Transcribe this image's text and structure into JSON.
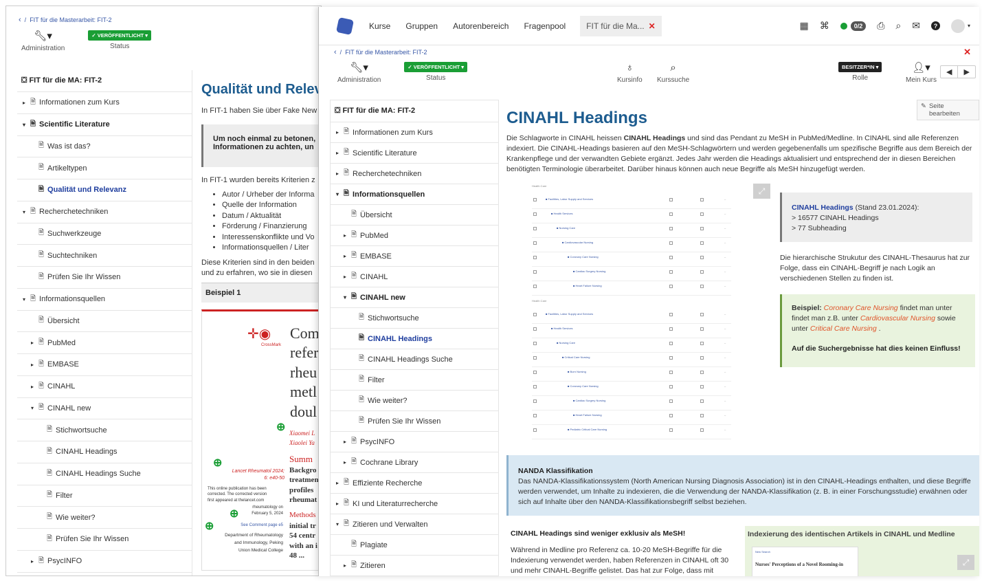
{
  "back": {
    "breadcrumb": {
      "back_icon": "chevron-left-icon",
      "sep": "/",
      "label": "FIT für die Masterarbeit: FIT-2"
    },
    "toolbar": {
      "admin": "Administration",
      "publish": "✓ VERÖFFENTLICHT ▾",
      "status": "Status"
    },
    "menu": {
      "title": "FIT für die MA: FIT-2",
      "items": [
        {
          "label": "Informationen zum Kurs",
          "caret": "▸",
          "level": 0
        },
        {
          "label": "Scientific Literature",
          "caret": "▾",
          "level": 0
        },
        {
          "label": "Was ist das?",
          "caret": "",
          "level": 1
        },
        {
          "label": "Artikeltypen",
          "caret": "",
          "level": 1
        },
        {
          "label": "Qualität und Relevanz",
          "caret": "",
          "level": 1
        },
        {
          "label": "Recherchetechniken",
          "caret": "▾",
          "level": 0
        },
        {
          "label": "Suchwerkzeuge",
          "caret": "",
          "level": 1
        },
        {
          "label": "Suchtechniken",
          "caret": "",
          "level": 1
        },
        {
          "label": "Prüfen Sie Ihr Wissen",
          "caret": "",
          "level": 1
        },
        {
          "label": "Informationsquellen",
          "caret": "▾",
          "level": 0
        },
        {
          "label": "Übersicht",
          "caret": "",
          "level": 1
        },
        {
          "label": "PubMed",
          "caret": "▸",
          "level": 1
        },
        {
          "label": "EMBASE",
          "caret": "▸",
          "level": 1
        },
        {
          "label": "CINAHL",
          "caret": "▸",
          "level": 1
        },
        {
          "label": "CINAHL new",
          "caret": "▾",
          "level": 1
        },
        {
          "label": "Stichwortsuche",
          "caret": "",
          "level": 2
        },
        {
          "label": "CINAHL Headings",
          "caret": "",
          "level": 2
        },
        {
          "label": "CINAHL Headings Suche",
          "caret": "",
          "level": 2
        },
        {
          "label": "Filter",
          "caret": "",
          "level": 2
        },
        {
          "label": "Wie weiter?",
          "caret": "",
          "level": 2
        },
        {
          "label": "Prüfen Sie Ihr Wissen",
          "caret": "",
          "level": 2
        },
        {
          "label": "PsycINFO",
          "caret": "▸",
          "level": 1
        }
      ]
    },
    "content": {
      "title": "Qualität und Relev",
      "intro": "In FIT-1 haben Sie über Fake New",
      "box": "Um noch einmal zu betonen,\nInformationen zu achten, un",
      "criteria_intro": "In FIT-1 wurden bereits Kriterien z",
      "criteria": [
        "Autor / Urheber der Informa",
        "Quelle der Information",
        "Datum / Aktualität",
        "Förderung / Finanzierung",
        "Interessenskonflikte und Vo",
        "Informationsquellen / Liter"
      ],
      "after": "Diese Kriterien sind in den beiden\nund zu erfahren, wo sie in diesen",
      "example_label": "Beispiel 1",
      "paper": {
        "logo": "CrossMark",
        "title_lines": [
          "Com",
          "refer",
          "rheu",
          "metl",
          "doul"
        ],
        "authors1": "Xiaomei L",
        "authors2": "Xiaolei Ya",
        "summary": "Summ",
        "summary_lines": [
          "Backgro",
          "treatmen",
          "profiles",
          "rheumat"
        ],
        "journal": "Lancet Rheumatol 2024;\n6: e40-50",
        "online_note": "This online publication has been\ncorrected. The corrected version\nfirst appeared at thelancet.com",
        "rheum": "rheumatology on\nFebruary 5, 2024",
        "see_comment": "See Comment page e5",
        "dept": "Department of Rheumatology\nand Immunology, Peking\nUnion Medical College",
        "methods": "Methods",
        "methods_lines": [
          "initial tr",
          "54 centr",
          "with an i",
          "48 ..."
        ]
      }
    }
  },
  "front": {
    "nav": {
      "items": [
        "Kurse",
        "Gruppen",
        "Autorenbereich",
        "Fragenpool"
      ],
      "active_tab": "FIT für die Ma...",
      "close": "✕",
      "badge": "0/2",
      "icons": [
        "calendar-icon",
        "rss-icon",
        "online-dot-icon",
        "print-icon",
        "search-icon",
        "mail-icon",
        "help-icon",
        "avatar"
      ]
    },
    "breadcrumb": {
      "label": "FIT für die Masterarbeit: FIT-2",
      "sep": "/",
      "close": "✕"
    },
    "toolbar": {
      "admin": "Administration",
      "publish": "✓ VERÖFFENTLICHT ▾",
      "status": "Status",
      "kursinfo": "Kursinfo",
      "kurssuche": "Kurssuche",
      "role_btn": "BESITZER*IN ▾",
      "role": "Rolle",
      "mein_kurs": "Mein Kurs"
    },
    "menu": {
      "title": "FIT für die MA: FIT-2",
      "items": [
        {
          "label": "Informationen zum Kurs",
          "caret": "▸",
          "level": 0
        },
        {
          "label": "Scientific Literature",
          "caret": "▸",
          "level": 0
        },
        {
          "label": "Recherchetechniken",
          "caret": "▸",
          "level": 0
        },
        {
          "label": "Informationsquellen",
          "caret": "▾",
          "level": 0
        },
        {
          "label": "Übersicht",
          "caret": "",
          "level": 1
        },
        {
          "label": "PubMed",
          "caret": "▸",
          "level": 1
        },
        {
          "label": "EMBASE",
          "caret": "▸",
          "level": 1
        },
        {
          "label": "CINAHL",
          "caret": "▸",
          "level": 1
        },
        {
          "label": "CINAHL new",
          "caret": "▾",
          "level": 1
        },
        {
          "label": "Stichwortsuche",
          "caret": "",
          "level": 2
        },
        {
          "label": "CINAHL Headings",
          "caret": "",
          "level": 2
        },
        {
          "label": "CINAHL Headings Suche",
          "caret": "",
          "level": 2
        },
        {
          "label": "Filter",
          "caret": "",
          "level": 2
        },
        {
          "label": "Wie weiter?",
          "caret": "",
          "level": 2
        },
        {
          "label": "Prüfen Sie Ihr Wissen",
          "caret": "",
          "level": 2
        },
        {
          "label": "PsycINFO",
          "caret": "▸",
          "level": 1
        },
        {
          "label": "Cochrane Library",
          "caret": "▸",
          "level": 1
        },
        {
          "label": "Effiziente Recherche",
          "caret": "▸",
          "level": 0
        },
        {
          "label": "KI und Literaturrecherche",
          "caret": "▸",
          "level": 0
        },
        {
          "label": "Zitieren und Verwalten",
          "caret": "▾",
          "level": 0
        },
        {
          "label": "Plagiate",
          "caret": "",
          "level": 1
        },
        {
          "label": "Zitieren",
          "caret": "▸",
          "level": 1
        }
      ]
    },
    "content": {
      "edit": "Seite bearbeiten",
      "title": "CINAHL Headings",
      "intro_parts": [
        "Die Schlagworte in CINAHL heissen ",
        "CINAHL Headings",
        " und sind das Pendant zu MeSH in PubMed/Medline. In CINAHL sind alle Referenzen indexiert. Die CINAHL-Headings basieren auf den MeSH-Schlagwörtern und werden gegebenenfalls um spezifische Begriffe aus dem Bereich der Krankenpflege und der verwandten Gebiete ergänzt. Jedes Jahr werden die Headings aktualisiert und entsprechend der in diesen Bereichen benötigten Terminologie überarbeitet. Darüber hinaus können auch neue Begriffe als MeSH hinzugefügt werden."
      ],
      "tree": {
        "group1": "Health Care",
        "group2": "Health Care",
        "rows1": [
          "Facilities, Labor Supply and Services",
          "Health Services",
          "Nursing Care",
          "Cardiovascular Nursing",
          "Coronary Care Nursing",
          "Cardiac Surgery Nursing",
          "Heart Failure Nursing"
        ],
        "rows2": [
          "Facilities, Labor Supply and Services",
          "Health Services",
          "Nursing Care",
          "Critical Care Nursing",
          "Burn Nursing",
          "Coronary Care Nursing",
          "Cardiac Surgery Nursing",
          "Heart Failure Nursing",
          "Pediatric Critical Care Nursing"
        ]
      },
      "stats": {
        "link": "CINAHL Headings",
        "date": " (Stand 23.01.2024):",
        "l1": "> 16577 CINAHL Headings",
        "l2": "> 77 Subheading"
      },
      "hier": "Die hierarchische Strukutur des CINAHL-Thesaurus hat zur Folge, dass ein CINAHL-Begriff je nach Logik an verschiedenen Stellen zu finden ist.",
      "example": {
        "label": "Beispiel:",
        "t1": " Coronary Care Nursing",
        "t2": " findet man unter findet man z.B. unter ",
        "t3": "Cardiovascular Nursing",
        "t4": " sowie unter ",
        "t5": "Critical Care Nursing",
        "t6": " .",
        "bold": "Auf die Suchergebnisse hat dies keinen Einfluss!"
      },
      "nanda": {
        "title": "NANDA Klassifikation",
        "text": "Das NANDA-Klassifikationssystem (North American Nursing Diagnosis Association) ist in den CINAHL-Headings enthalten, und diese Begriffe werden verwendet, um Inhalte zu indexieren, die die Verwendung der NANDA-Klassifikation (z. B. in einer Forschungsstudie) erwähnen oder sich auf Inhalte über den NANDA-Klassifikationsbegriff selbst beziehen."
      },
      "exclusive": {
        "title": "CINAHL Headings sind weniger exklusiv als MeSH!",
        "text": "Während in Medline pro Referenz ca. 10-20 MeSH-Begriffe für die Indexierung verwendet werden, haben Referenzen in CINAHL oft 30 und mehr CINAHL-Begriffe gelistet. Das hat zur Folge, dass mit"
      },
      "index": {
        "title": "Indexierung des identischen Artikels in CINAHL und Medline",
        "paper_title": "Nurses' Perceptions of a Novel Rooming-in",
        "small": "New Search"
      }
    }
  },
  "colors": {
    "accent": "#1d5c8f",
    "link": "#1f3e9e",
    "publish": "#1a9e35",
    "red": "#d22",
    "orange": "#e0542a"
  }
}
